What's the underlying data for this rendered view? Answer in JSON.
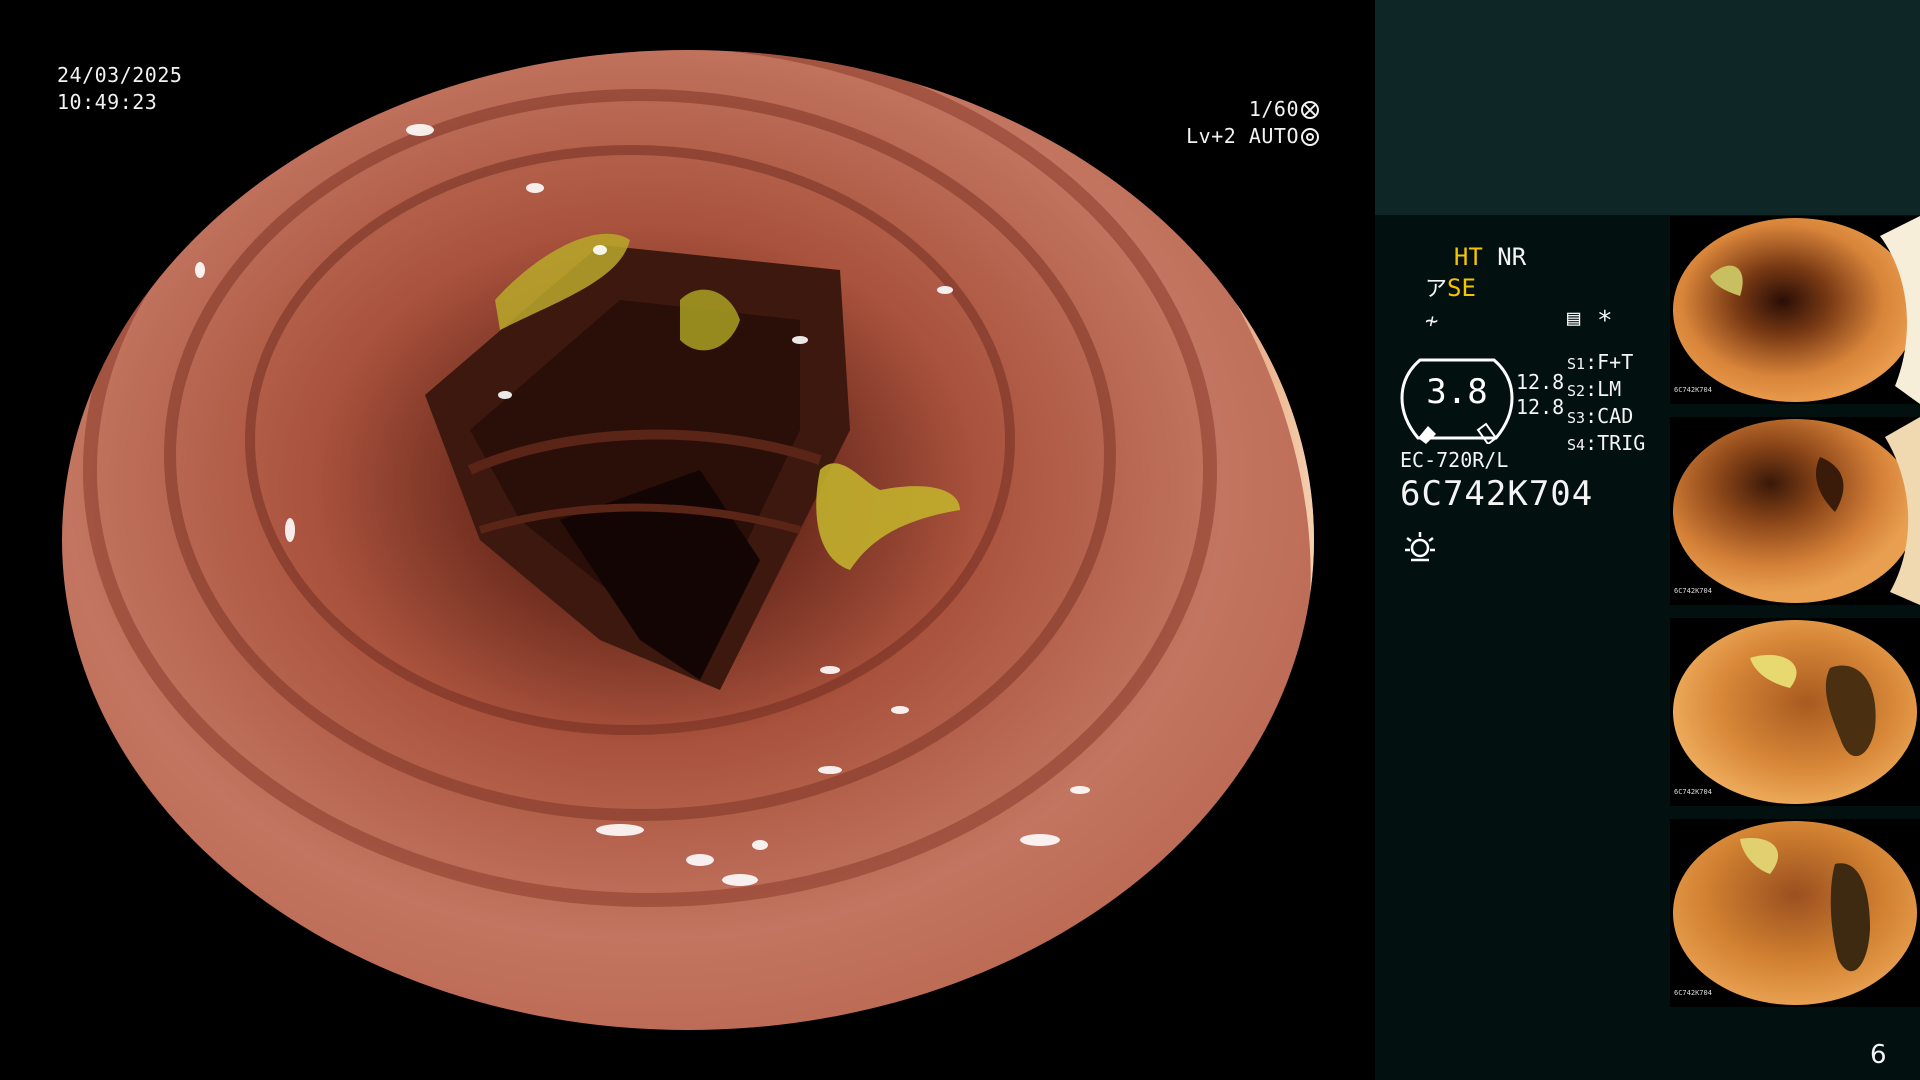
{
  "osd": {
    "date": "24/03/2025",
    "time": "10:49:23",
    "shutter": "1/60",
    "level": "Lv+2 AUTO"
  },
  "panel": {
    "mode_ht": "HT",
    "mode_nr": "NR",
    "mode_se": "SE",
    "gauge_value": "3.8",
    "right_values": [
      "12.8",
      "12.8"
    ],
    "slots": [
      {
        "key": "S1",
        "label": "F+T"
      },
      {
        "key": "S2",
        "label": "LM"
      },
      {
        "key": "S3",
        "label": "CAD"
      },
      {
        "key": "S4",
        "label": "TRIG"
      }
    ],
    "star": "*",
    "model": "EC-720R/L",
    "serial": "6C742K704",
    "page_number": "6",
    "thumbnails": [
      {
        "serial": "6C742K704"
      },
      {
        "serial": "6C742K704"
      },
      {
        "serial": "6C742K704"
      },
      {
        "serial": "6C742K704"
      }
    ]
  },
  "colors": {
    "panel_bg": "#02100f",
    "panel_top": "#0e2626",
    "mode_highlight": "#f4c400",
    "mucosa": "#b86a55",
    "residue": "#b8b02a"
  },
  "icons": [
    "shutter-icon",
    "auto-level-icon",
    "memo-icon",
    "light-source-icon",
    "filter-icon",
    "enhance-icon"
  ]
}
